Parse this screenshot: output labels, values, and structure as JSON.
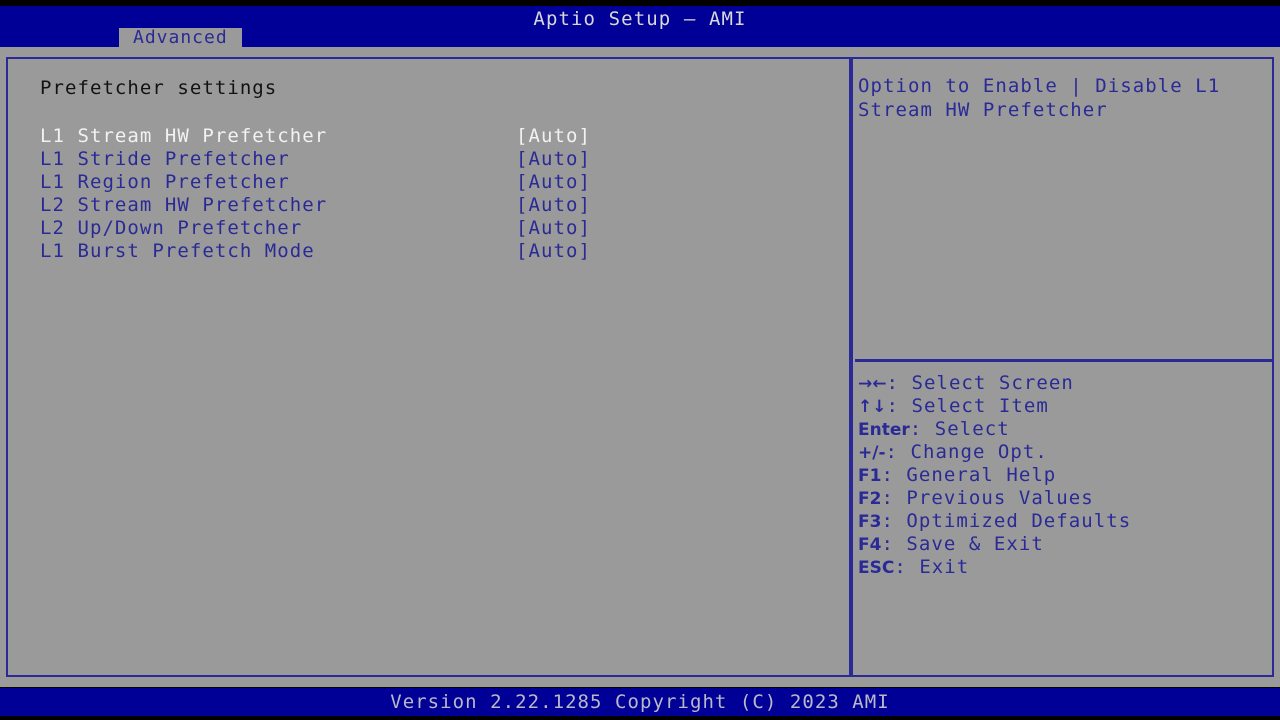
{
  "header": {
    "title": "Aptio Setup – AMI",
    "tabs": [
      {
        "label": "Advanced",
        "active": true
      }
    ]
  },
  "main": {
    "section_heading": "Prefetcher settings",
    "items": [
      {
        "label": "L1 Stream HW Prefetcher",
        "value": "[Auto]",
        "selected": true
      },
      {
        "label": "L1 Stride Prefetcher",
        "value": "[Auto]",
        "selected": false
      },
      {
        "label": "L1 Region Prefetcher",
        "value": "[Auto]",
        "selected": false
      },
      {
        "label": "L2 Stream HW Prefetcher",
        "value": "[Auto]",
        "selected": false
      },
      {
        "label": "L2 Up/Down Prefetcher",
        "value": "[Auto]",
        "selected": false
      },
      {
        "label": "L1 Burst Prefetch Mode",
        "value": "[Auto]",
        "selected": false
      }
    ]
  },
  "help": {
    "description": "Option to Enable | Disable L1 Stream HW Prefetcher",
    "legend": [
      {
        "keys": "→←",
        "action": ": Select Screen"
      },
      {
        "keys": "↑↓",
        "action": ": Select Item"
      },
      {
        "keys": "Enter",
        "action": ": Select"
      },
      {
        "keys": "+/-",
        "action": ": Change Opt."
      },
      {
        "keys": "F1",
        "action": ": General Help"
      },
      {
        "keys": "F2",
        "action": ": Previous Values"
      },
      {
        "keys": "F3",
        "action": ": Optimized Defaults"
      },
      {
        "keys": "F4",
        "action": ": Save & Exit"
      },
      {
        "keys": "ESC",
        "action": ": Exit"
      }
    ]
  },
  "footer": {
    "version_text": "Version 2.22.1285 Copyright (C) 2023 AMI"
  },
  "colors": {
    "background_gray": "#9a9a9a",
    "accent_blue": "#2a2a96",
    "header_blue": "#000096",
    "selected_text": "#f2f2f2",
    "heading_text": "#121212"
  }
}
